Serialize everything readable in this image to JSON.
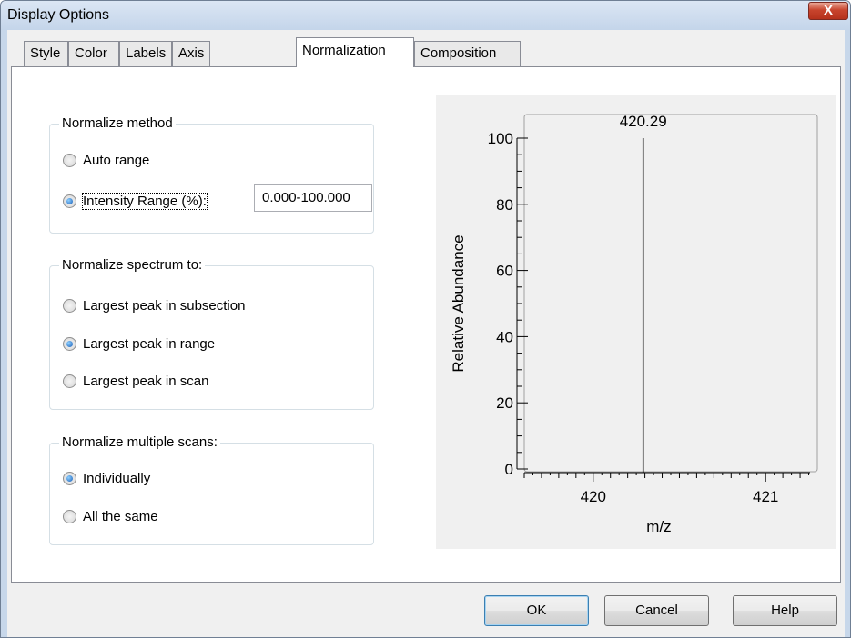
{
  "window": {
    "title": "Display Options",
    "close_label": "X"
  },
  "tabs": [
    {
      "label": "Style"
    },
    {
      "label": "Color"
    },
    {
      "label": "Labels"
    },
    {
      "label": "Axis"
    },
    {
      "label": "Normalization",
      "active": true
    },
    {
      "label": "Composition"
    }
  ],
  "normalize_method": {
    "title": "Normalize method",
    "options": [
      {
        "label": "Auto range",
        "checked": false
      },
      {
        "label": "Intensity Range (%):",
        "checked": true
      }
    ],
    "range_value": "0.000-100.000"
  },
  "normalize_spectrum": {
    "title": "Normalize spectrum to:",
    "options": [
      {
        "label": "Largest peak in subsection",
        "checked": false
      },
      {
        "label": "Largest peak in range",
        "checked": true
      },
      {
        "label": "Largest peak in scan",
        "checked": false
      }
    ]
  },
  "normalize_multiple": {
    "title": "Normalize multiple scans:",
    "options": [
      {
        "label": "Individually",
        "checked": true
      },
      {
        "label": "All the same",
        "checked": false
      }
    ]
  },
  "buttons": {
    "ok": "OK",
    "cancel": "Cancel",
    "help": "Help"
  },
  "chart_data": {
    "type": "bar",
    "xlabel": "m/z",
    "ylabel": "Relative Abundance",
    "xlim": [
      419.6,
      421.3
    ],
    "ylim": [
      0,
      100
    ],
    "x_ticks": [
      420,
      421
    ],
    "y_ticks": [
      0,
      20,
      40,
      60,
      80,
      100
    ],
    "peaks": [
      {
        "x": 420.29,
        "y": 100,
        "label": "420.29"
      }
    ],
    "grid": false
  }
}
